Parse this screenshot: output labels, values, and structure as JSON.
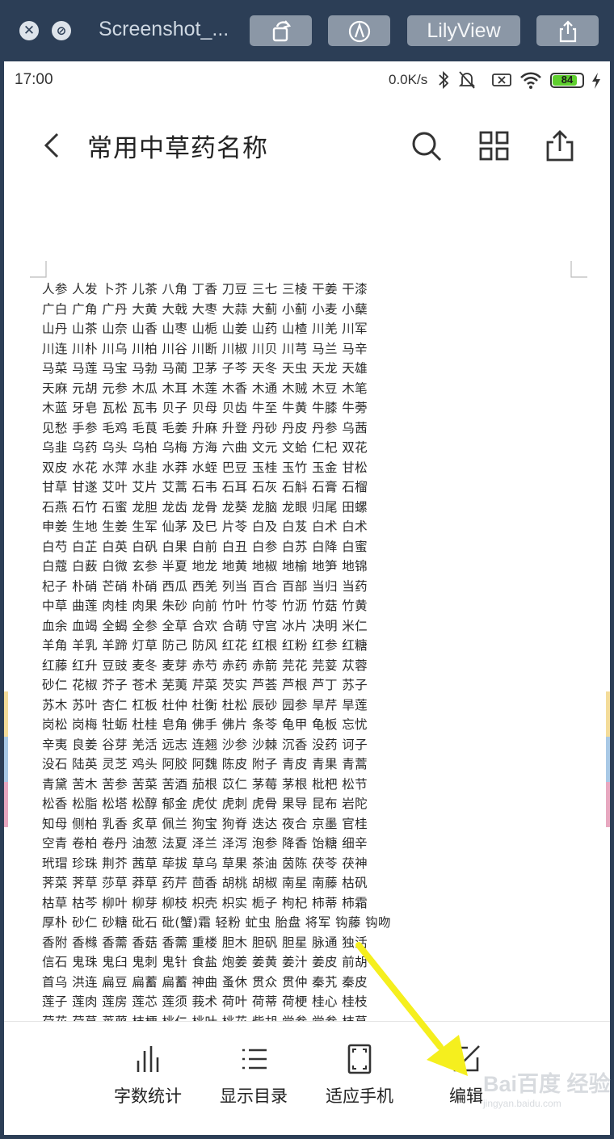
{
  "window": {
    "title": "Screenshot_...",
    "lilyview_label": "LilyView"
  },
  "status": {
    "time": "17:00",
    "speed": "0.0K/s",
    "battery": "84",
    "battery_level": 0.84
  },
  "header": {
    "title": "常用中草药名称"
  },
  "document": {
    "lines": [
      "人参 人发 卜芥 儿茶 八角 丁香 刀豆 三七 三棱 干姜 干漆",
      "广白 广角 广丹 大黄 大戟 大枣 大蒜 大蓟 小蓟 小麦 小蘖",
      "山丹 山茶 山奈 山香 山枣 山栀 山姜 山药 山楂 川羌 川军",
      "川连 川朴 川乌 川柏 川谷 川断 川椒 川贝 川芎 马兰 马辛",
      "马菜 马莲 马宝 马勃 马蔺 卫茅 子芩 天冬 天虫 天龙 天雄",
      "天麻 元胡 元参 木瓜 木耳 木莲 木香 木通 木贼 木豆 木笔",
      "木蓝 牙皂 瓦松 瓦韦 贝子 贝母 贝齿 牛至 牛黄 牛膝 牛蒡",
      "见愁 手参 毛鸡 毛茛 毛姜 升麻 升登 丹砂 丹皮 丹参 乌茜",
      "乌韭 乌药 乌头 乌柏 乌梅 方海 六曲 文元 文蛤 仁杞 双花",
      "双皮 水花 水萍 水韭 水莽 水蛭 巴豆 玉桂 玉竹 玉金 甘松",
      "甘草 甘遂 艾叶 艾片 艾蒿 石韦 石耳 石灰 石斛 石膏 石榴",
      "石燕 石竹 石蜜 龙胆 龙齿 龙骨 龙葵 龙脑 龙眼 归尾 田螺",
      "申姜 生地 生姜 生军 仙茅 及巳 片苓 白及 白芨 白术 白术",
      "白芍 白芷 白英 白矾 白果 白前 白丑 白参 白苏 白降 白蜜",
      "白蔻 白薮 白微 玄参 半夏 地龙 地黄 地椒 地榆 地笋 地锦",
      "杞子 朴硝 芒硝 朴硝 西瓜 西羌 列当 百合 百部 当归 当药",
      "中草 曲莲 肉桂 肉果 朱砂 向前 竹叶 竹苓 竹沥 竹菇 竹黄",
      "血余 血竭 全蝎 全参 全草 合欢 合萌 守宫 冰片 决明 米仁",
      "羊角 羊乳 羊蹄 灯草 防己 防风 红花 红根 红粉 红参 红糖",
      "红藤 红升 豆豉 麦冬 麦芽 赤芍 赤药 赤箭 芫花 芫荽 苁蓉",
      "砂仁 花椒 芥子 苍术 芜荑 芹菜 芡实 芦荟 芦根 芦丁 苏子",
      "苏木 苏叶 杏仁 杠板 杜仲 杜衡 杜松 辰砂 园参 旱芹 旱莲",
      "岗松 岗梅 牡蛎 杜桂 皂角 佛手 佛片 条苓 龟甲 龟板 忘忧",
      "辛夷 良姜 谷芽 羌活 远志 连翘 沙参 沙棘 沉香 没药 诃子",
      "没石 陆英 灵芝 鸡头 阿胶 阿魏 陈皮 附子 青皮 青果 青蒿",
      "青黛 苦木 苦参 苦菜 苦酒 茄根 苡仁 茅莓 茅根 枇杷 松节",
      "松香 松脂 松塔 松醇 郁金 虎仗 虎刺 虎骨 果导 昆布 岩陀",
      "知母 侧柏 乳香 炙草 佩兰 狗宝 狗脊 迭达 夜合 京墨 官桂",
      "空青 卷柏 卷丹 油葱 法夏 泽兰 泽泻 泡参 降香 饴糖 细辛",
      "玳瑁 珍珠 荆芥 茜草 荜拔 草乌 草果 茶油 茵陈 茯苓 茯神",
      "荠菜 荠草 莎草 莽草 药芹 茴香 胡桃 胡椒 南星 南藤 枯矾",
      "枯草 枯芩 柳叶 柳芽 柳枝 枳壳 枳实 栀子 枸杞 柿蒂 柿霜",
      "厚朴 砂仁 砂糖 砒石 砒(蟹)霜 轻粉 虻虫 胎盘 将军 钩藤 钩吻",
      "香附 香橼 香薷 香菇 香薷 重楼 胆木 胆矾 胆星 脉通 独活",
      "信石 鬼珠 鬼臼 鬼刺 鬼针 食盐 炮姜 姜黄 姜汁 姜皮 前胡",
      "首乌 洪连 扁豆 扁蓄 扁蓄 神曲 蚤休 贯众 贯仲 秦艽 秦皮",
      "莲子 莲肉 莲房 莲芯 莲须 莪术 荷叶 荷蒂 荷梗 桂心 桂枝",
      "荷花 荷草 莱菔 桔梗 桃仁 桃叶 桃花 柴胡 党参 党参 桔草"
    ]
  },
  "toolbar": {
    "items": [
      {
        "label": "字数统计"
      },
      {
        "label": "显示目录"
      },
      {
        "label": "适应手机"
      },
      {
        "label": "编辑"
      }
    ]
  },
  "watermark": {
    "brand": "Bai百度 经验",
    "url": "jingyan.baidu.com"
  },
  "colors": {
    "window_bg": "#2c3e56",
    "annotation_arrow": "#f5ef1e",
    "battery": "#5fcf2e"
  }
}
